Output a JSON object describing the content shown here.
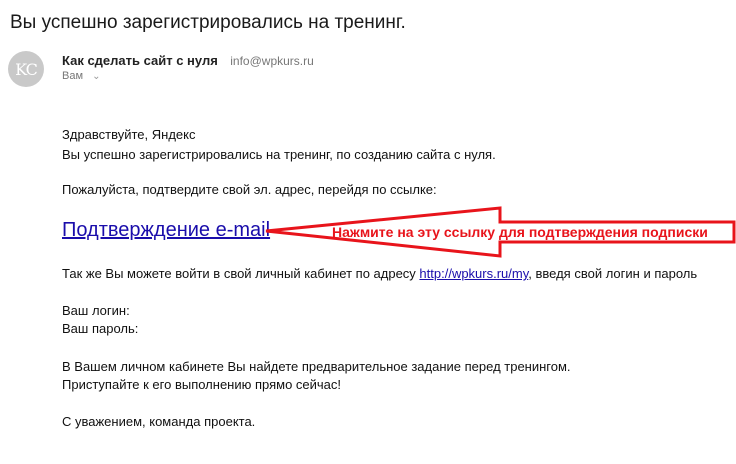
{
  "email": {
    "subject": "Вы успешно зарегистрировались на тренинг.",
    "avatar_initials": "KC",
    "sender_name": "Как сделать сайт с нуля",
    "sender_email": "info@wpkurs.ru",
    "recipient": "Вам"
  },
  "body": {
    "greeting": "Здравствуйте, Яндекс",
    "line_registered": "Вы успешно зарегистрировались на тренинг, по созданию сайта с нуля.",
    "line_confirm_prompt": "Пожалуйста, подтвердите свой эл. адрес, перейдя по ссылке:",
    "confirm_link": "Подтверждение e-mail",
    "cabinet_before": "Так же Вы можете войти в свой личный кабинет по адресу ",
    "cabinet_link": "http://wpkurs.ru/my",
    "cabinet_after": ", введя свой логин и пароль",
    "login_label": "Ваш логин:",
    "password_label": "Ваш пароль:",
    "task_line1": "В Вашем личном кабинете Вы найдете предварительное задание перед тренингом.",
    "task_line2": "Приступайте к его выполнению прямо сейчас!",
    "signature": "С уважением, команда проекта."
  },
  "annotation": {
    "text": "Нажмите на эту ссылку для подтверждения подписки",
    "color": "#e8141b"
  },
  "colors": {
    "link": "#1a0dab",
    "avatar_bg": "#c9c9c9"
  }
}
